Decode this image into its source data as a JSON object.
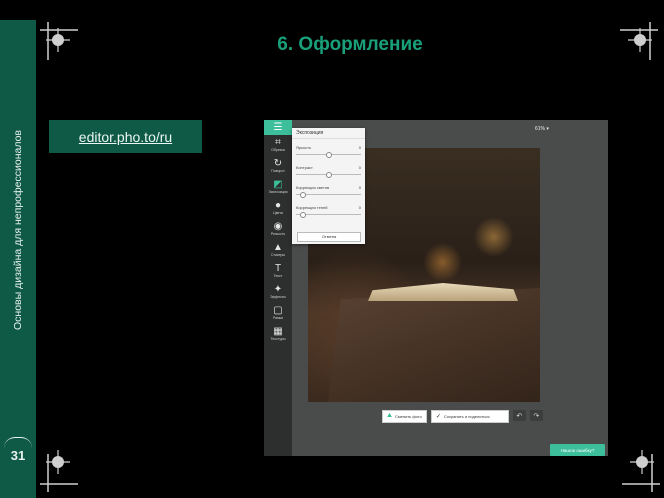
{
  "slide": {
    "title": "6. Оформление",
    "sidebar_text": "Основы дизайна для непрофессионалов",
    "page_number": "31",
    "link_text": "editor.pho.to/ru"
  },
  "editor": {
    "menu_icon": "menu-icon",
    "zoom_label": "61% ▾",
    "tools": [
      {
        "icon": "crop-icon",
        "label": "Обрезка"
      },
      {
        "icon": "rotate-icon",
        "label": "Поворот"
      },
      {
        "icon": "exposure-icon",
        "label": "Экспозиция"
      },
      {
        "icon": "color-icon",
        "label": "Цвета"
      },
      {
        "icon": "sharpness-icon",
        "label": "Резкость"
      },
      {
        "icon": "sticker-icon",
        "label": "Стикеры"
      },
      {
        "icon": "text-icon",
        "label": "Текст"
      },
      {
        "icon": "effects-icon",
        "label": "Эффекты"
      },
      {
        "icon": "frame-icon",
        "label": "Рамки"
      },
      {
        "icon": "texture-icon",
        "label": "Текстуры"
      }
    ],
    "panel": {
      "title": "Экспозиция",
      "sliders": [
        {
          "label": "Яркость",
          "value": "0"
        },
        {
          "label": "Контраст",
          "value": "0"
        },
        {
          "label": "Коррекция светов",
          "value": "0"
        },
        {
          "label": "Коррекция теней",
          "value": "0"
        }
      ],
      "cancel_label": "Отмена"
    },
    "bottom": {
      "change_photo": "Сменить фото",
      "save_share": "Сохранить и поделиться",
      "undo_icon": "undo-icon",
      "redo_icon": "redo-icon"
    },
    "help_label": "Нашли ошибку?"
  },
  "colors": {
    "accent": "#3cbf9a",
    "sidebar": "#0f5a47",
    "title": "#19a07a"
  }
}
